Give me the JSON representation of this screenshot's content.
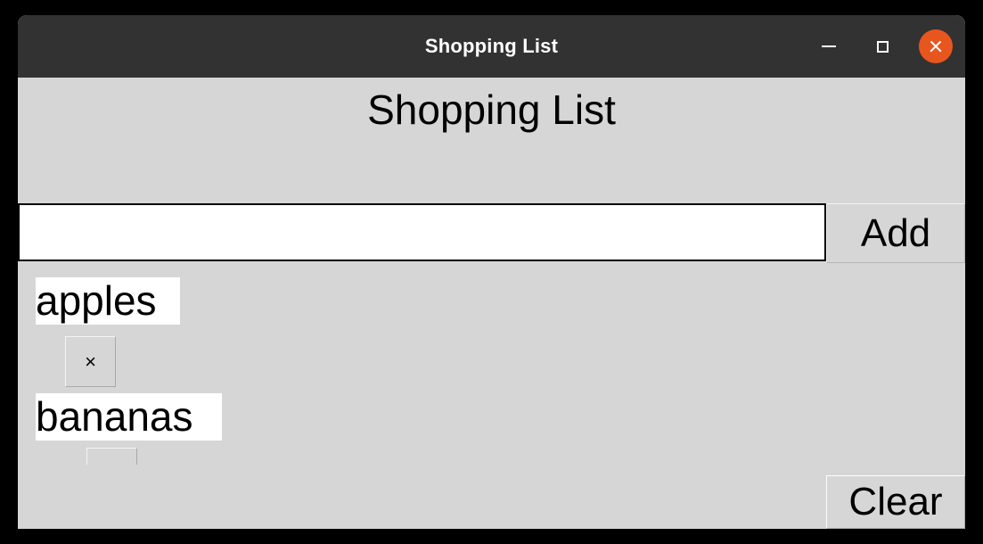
{
  "window": {
    "title": "Shopping List",
    "controls": {
      "minimize_label": "–",
      "maximize_label": "□",
      "close_label": "×"
    },
    "colors": {
      "titlebar_bg": "#323232",
      "close_bg": "#e8561f",
      "app_bg": "#d6d6d6",
      "filler_bar": "#a9a9a9",
      "text": "#000000"
    }
  },
  "app": {
    "heading": "Shopping List",
    "input": {
      "value": "",
      "placeholder": ""
    },
    "add_label": "Add",
    "clear_label": "Clear",
    "items": [
      {
        "label": "apples",
        "remove_label": "×"
      },
      {
        "label": "bananas",
        "remove_label": "×"
      }
    ]
  }
}
